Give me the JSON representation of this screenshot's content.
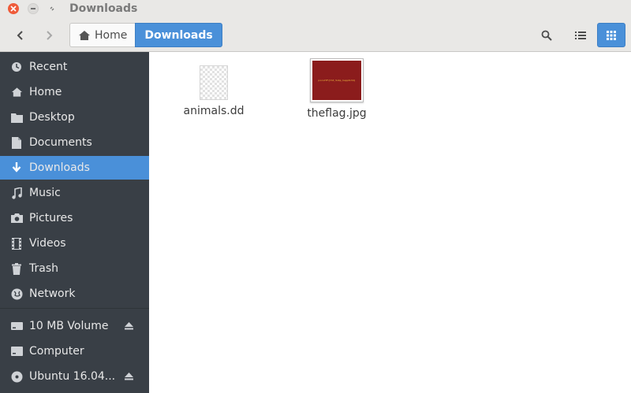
{
  "window": {
    "title": "Downloads"
  },
  "breadcrumb": {
    "home_label": "Home",
    "current_label": "Downloads"
  },
  "sidebar": {
    "items": [
      {
        "label": "Recent",
        "icon": "clock-icon"
      },
      {
        "label": "Home",
        "icon": "home-icon"
      },
      {
        "label": "Desktop",
        "icon": "folder-icon"
      },
      {
        "label": "Documents",
        "icon": "document-icon"
      },
      {
        "label": "Downloads",
        "icon": "download-icon",
        "active": true
      },
      {
        "label": "Music",
        "icon": "music-icon"
      },
      {
        "label": "Pictures",
        "icon": "camera-icon"
      },
      {
        "label": "Videos",
        "icon": "film-icon"
      },
      {
        "label": "Trash",
        "icon": "trash-icon"
      },
      {
        "label": "Network",
        "icon": "network-icon"
      }
    ],
    "devices": [
      {
        "label": "10 MB Volume",
        "icon": "drive-icon",
        "ejectable": true
      },
      {
        "label": "Computer",
        "icon": "computer-icon",
        "ejectable": false
      },
      {
        "label": "Ubuntu 16.04...",
        "icon": "disc-icon",
        "ejectable": true
      }
    ]
  },
  "files": [
    {
      "name": "animals.dd",
      "type": "generic-file"
    },
    {
      "name": "theflag.jpg",
      "type": "image",
      "thumbnail_text": "picoCTF{th3_5n4p_happ3n3d}"
    }
  ],
  "colors": {
    "accent": "#4a90d9",
    "sidebar_bg": "#393f46",
    "close_button": "#ef5b3a",
    "flag_red": "#8b1c1c"
  }
}
